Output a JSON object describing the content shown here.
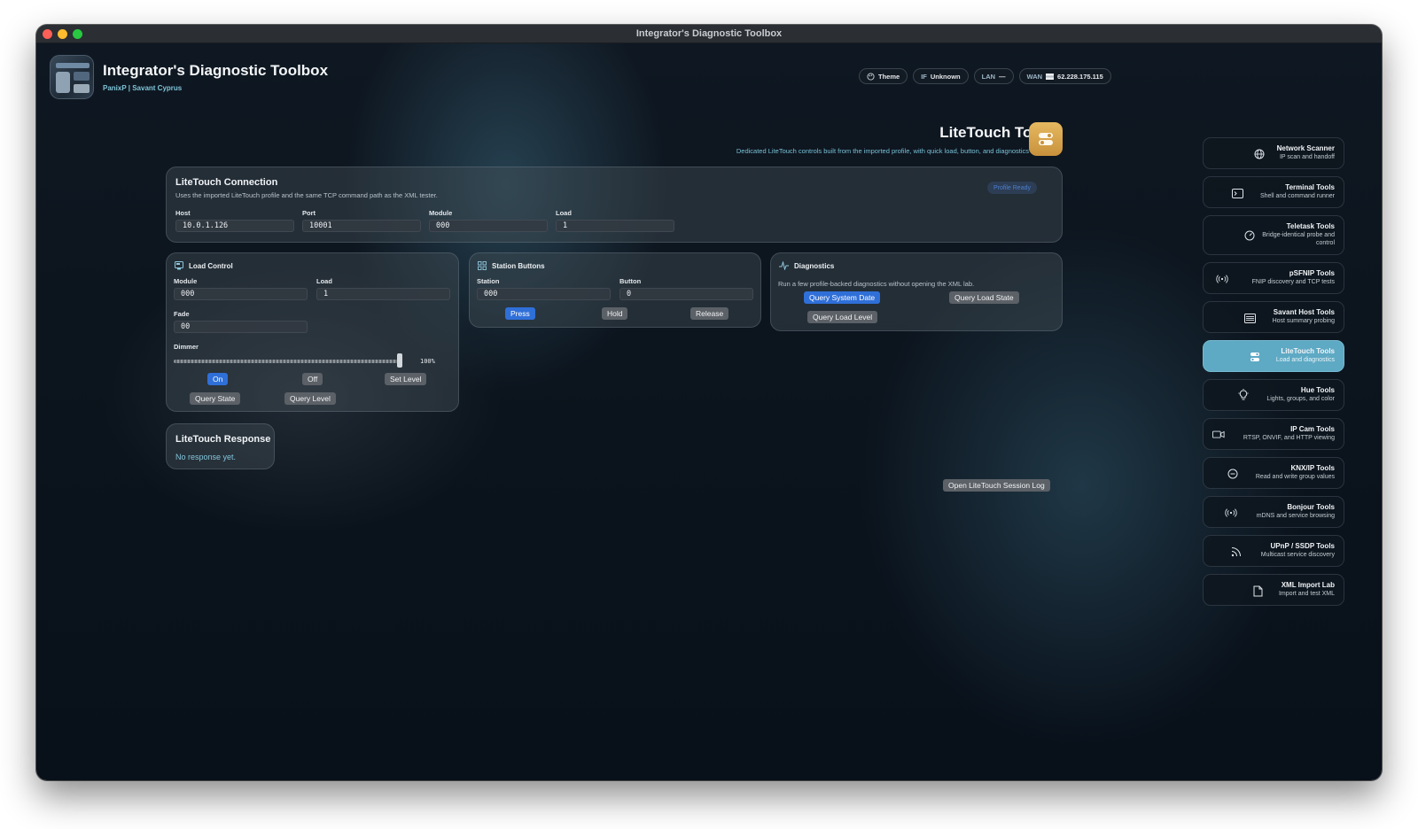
{
  "window": {
    "title": "Integrator's Diagnostic Toolbox"
  },
  "app": {
    "title": "Integrator's Diagnostic Toolbox",
    "subtitle": "PanixP | Savant Cyprus"
  },
  "chips": [
    {
      "key": "",
      "value": "Theme",
      "icon": "palette-icon"
    },
    {
      "key": "IF",
      "value": "Unknown"
    },
    {
      "key": "LAN",
      "value": "—"
    },
    {
      "key": "WAN",
      "value": "62.228.175.115",
      "icon": "flag-icon"
    }
  ],
  "page": {
    "title": "LiteTouch Tools",
    "subtitle": "Dedicated LiteTouch controls built from the imported profile, with quick load, button, and diagnostics actions."
  },
  "connection": {
    "title": "LiteTouch Connection",
    "desc": "Uses the imported LiteTouch profile and the same TCP command path as the XML tester.",
    "badge": "Profile Ready",
    "host_label": "Host",
    "host": "10.0.1.126",
    "port_label": "Port",
    "port": "10001",
    "module_label": "Module",
    "module": "000",
    "load_label": "Load",
    "load": "1"
  },
  "load_control": {
    "title": "Load Control",
    "module_label": "Module",
    "module": "000",
    "load_label": "Load",
    "load": "1",
    "fade_label": "Fade",
    "fade": "00",
    "dimmer_label": "Dimmer",
    "dimmer_level": 1.0,
    "dimmer_text": "100%",
    "on": "On",
    "off": "Off",
    "set_level": "Set Level",
    "query_state": "Query State",
    "query_level": "Query Level"
  },
  "station": {
    "title": "Station Buttons",
    "station_label": "Station",
    "station": "000",
    "button_label": "Button",
    "button": "0",
    "press": "Press",
    "hold": "Hold",
    "release": "Release"
  },
  "diagnostics": {
    "title": "Diagnostics",
    "desc": "Run a few profile-backed diagnostics without opening the XML lab.",
    "query_system_date": "Query System Date",
    "query_load_state": "Query Load State",
    "query_load_level": "Query Load Level"
  },
  "response": {
    "title": "LiteTouch Response",
    "text": "No response yet."
  },
  "session_log": "Open LiteTouch Session Log",
  "sidebar": {
    "items": [
      {
        "name": "Network Scanner",
        "desc": "IP scan and handoff",
        "icon": "globe-icon"
      },
      {
        "name": "Terminal Tools",
        "desc": "Shell and command runner",
        "icon": "terminal-icon"
      },
      {
        "name": "Teletask Tools",
        "desc": "Bridge-identical probe and control",
        "icon": "gauge-icon"
      },
      {
        "name": "pSFNIP Tools",
        "desc": "FNIP discovery and TCP tests",
        "icon": "broadcast-icon"
      },
      {
        "name": "Savant Host Tools",
        "desc": "Host summary probing",
        "icon": "server-icon"
      },
      {
        "name": "LiteTouch Tools",
        "desc": "Load and diagnostics",
        "icon": "toggle-icon"
      },
      {
        "name": "Hue Tools",
        "desc": "Lights, groups, and color",
        "icon": "lightbulb-icon"
      },
      {
        "name": "IP Cam Tools",
        "desc": "RTSP, ONVIF, and HTTP viewing",
        "icon": "camera-icon"
      },
      {
        "name": "KNX/IP Tools",
        "desc": "Read and write group values",
        "icon": "knx-icon"
      },
      {
        "name": "Bonjour Tools",
        "desc": "mDNS and service browsing",
        "icon": "antenna-icon"
      },
      {
        "name": "UPnP / SSDP Tools",
        "desc": "Multicast service discovery",
        "icon": "rss-icon"
      },
      {
        "name": "XML Import Lab",
        "desc": "Import and test XML",
        "icon": "document-icon"
      }
    ]
  }
}
